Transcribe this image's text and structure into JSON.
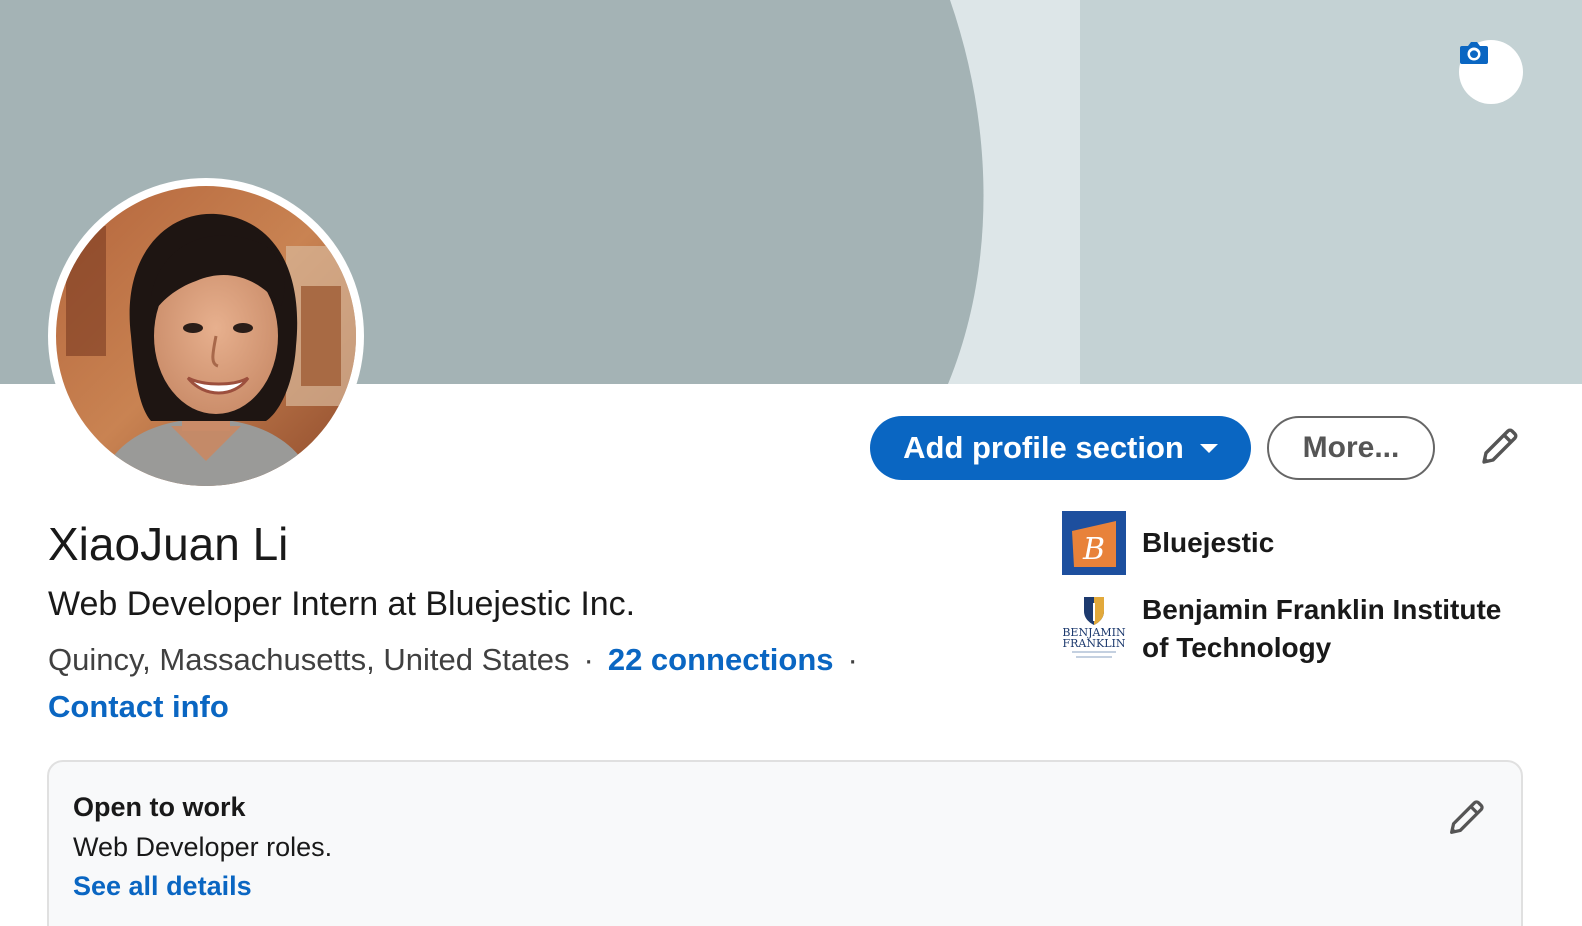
{
  "profile": {
    "name": "XiaoJuan Li",
    "headline": "Web Developer Intern at Bluejestic Inc.",
    "location": "Quincy, Massachusetts, United States",
    "separator": "·",
    "connections": "22 connections",
    "contact_info": "Contact info"
  },
  "actions": {
    "add_profile_section": "Add profile section",
    "more": "More..."
  },
  "organizations": [
    {
      "name": "Bluejestic",
      "logo_letter": "B"
    },
    {
      "name": "Benjamin Franklin Institute of Technology",
      "logo_text": [
        "BENJAMIN",
        "FRANKLIN"
      ]
    }
  ],
  "open_to_work": {
    "title": "Open to work",
    "description": "Web Developer roles.",
    "link": "See all details"
  },
  "icons": {
    "cover_camera": "camera-icon",
    "edit": "pencil-icon",
    "dropdown": "caret-down-icon"
  },
  "colors": {
    "brand_blue": "#0a66c2",
    "cover_dark": "#a4b3b5",
    "cover_light": "#c4d2d4",
    "cover_mid": "#dde6e8",
    "logo_orange": "#e8823a",
    "logo_blue": "#1d4f9e"
  }
}
